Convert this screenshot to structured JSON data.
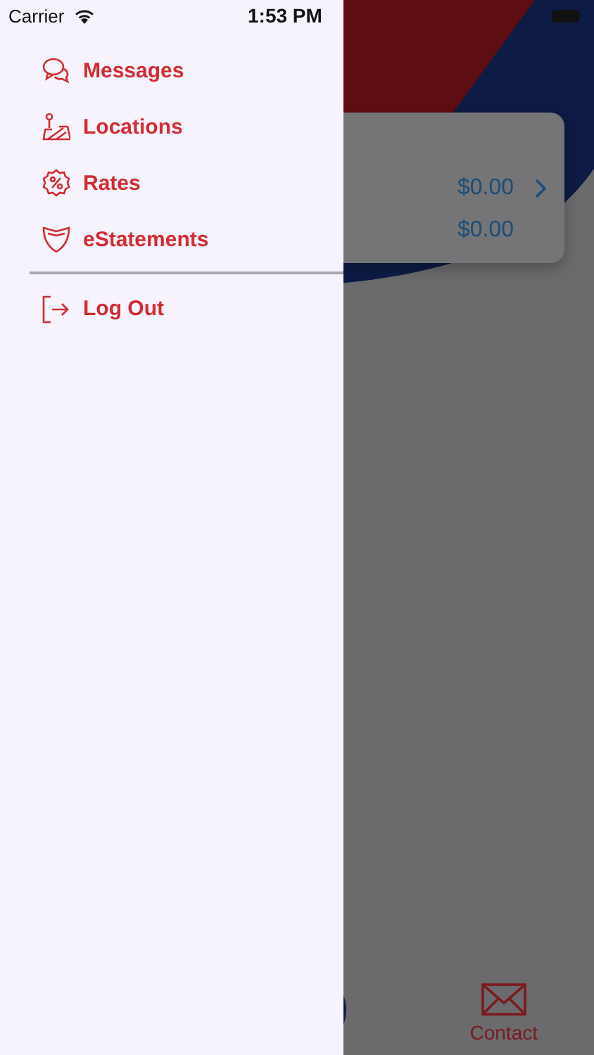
{
  "status_bar": {
    "carrier": "Carrier",
    "time": "1:53 PM"
  },
  "menu": {
    "items": [
      {
        "label": "Messages",
        "kind": "chat"
      },
      {
        "label": "Locations",
        "kind": "map"
      },
      {
        "label": "Rates",
        "kind": "percent"
      },
      {
        "label": "eStatements",
        "kind": "shield"
      }
    ],
    "footer_items": [
      {
        "label": "Log Out",
        "kind": "logout"
      }
    ]
  },
  "background": {
    "balances": [
      {
        "amount": "$0.00",
        "chevron": true
      },
      {
        "amount": "$0.00",
        "chevron": false
      }
    ],
    "tab_bar": [
      {
        "label": "Contact",
        "kind": "mail"
      }
    ]
  }
}
